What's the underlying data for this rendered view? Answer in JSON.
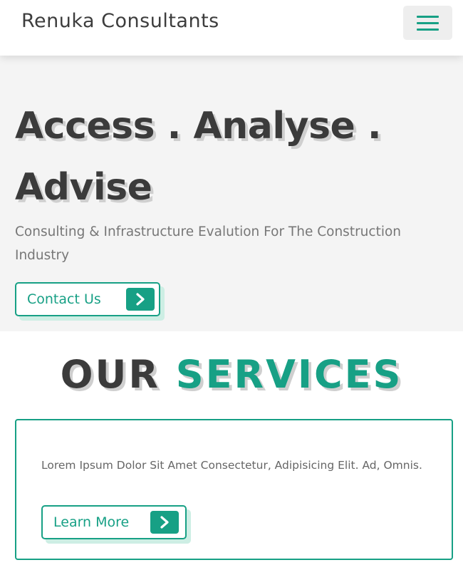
{
  "header": {
    "brand": "Renuka Consultants",
    "menu_icon": "hamburger-menu-icon"
  },
  "hero": {
    "title": "Access . Analyse . Advise",
    "subtitle": "Consulting & Infrastructure Evalution For The Construction Industry",
    "cta_label": "Contact Us",
    "cta_icon": "chevron-right-icon"
  },
  "services": {
    "heading_part1": "OUR",
    "heading_part2": "SERVICES",
    "card": {
      "text": "Lorem Ipsum Dolor Sit Amet Consectetur, Adipisicing Elit. Ad, Omnis.",
      "button_label": "Learn More",
      "button_icon": "chevron-right-icon"
    }
  },
  "colors": {
    "accent": "#17a085",
    "heading": "#3b3b3b",
    "hero_bg": "#f4f4f4",
    "text_muted": "#777777"
  }
}
